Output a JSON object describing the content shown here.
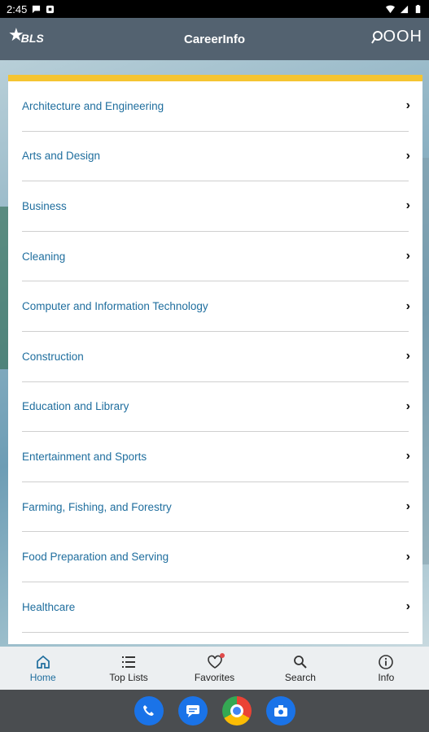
{
  "status_bar": {
    "time": "2:45"
  },
  "app_bar": {
    "title": "CareerInfo",
    "left_logo": "BLS",
    "right_logo": "OOH"
  },
  "categories": [
    "Architecture and Engineering",
    "Arts and Design",
    "Business",
    "Cleaning",
    "Computer and Information Technology",
    "Construction",
    "Education and Library",
    "Entertainment and Sports",
    "Farming, Fishing, and Forestry",
    "Food Preparation and Serving",
    "Healthcare"
  ],
  "bottom_nav": [
    {
      "label": "Home",
      "icon": "home-icon",
      "active": true
    },
    {
      "label": "Top Lists",
      "icon": "list-icon",
      "active": false
    },
    {
      "label": "Favorites",
      "icon": "heart-icon",
      "active": false
    },
    {
      "label": "Search",
      "icon": "search-icon",
      "active": false
    },
    {
      "label": "Info",
      "icon": "info-icon",
      "active": false
    }
  ],
  "dock": [
    "phone-app-icon",
    "messages-app-icon",
    "chrome-app-icon",
    "camera-app-icon"
  ],
  "colors": {
    "accent": "#f5c431",
    "link": "#1f6e9e",
    "app_bar": "#536270",
    "nav_active": "#1f6e9e"
  }
}
